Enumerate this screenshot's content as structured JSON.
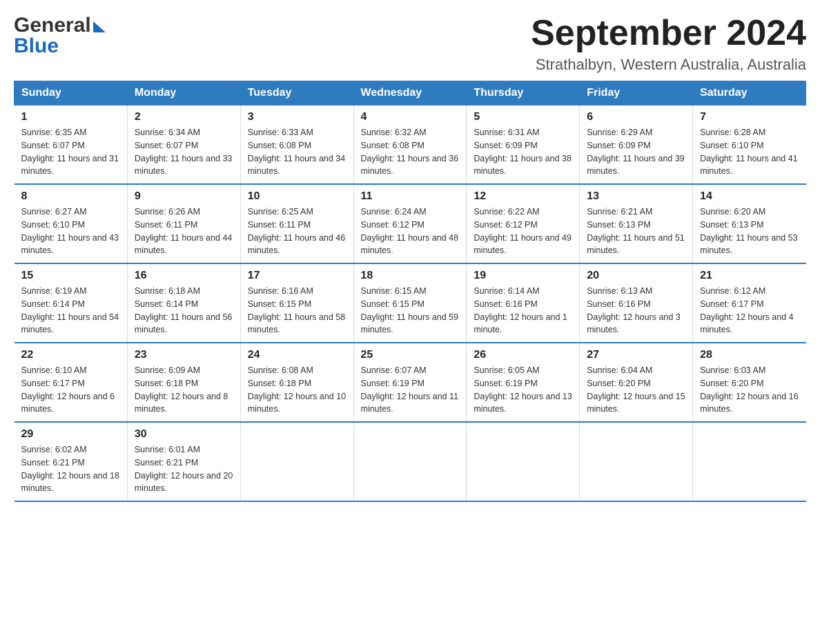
{
  "logo": {
    "general": "General",
    "blue": "Blue"
  },
  "title": "September 2024",
  "subtitle": "Strathalbyn, Western Australia, Australia",
  "weekdays": [
    "Sunday",
    "Monday",
    "Tuesday",
    "Wednesday",
    "Thursday",
    "Friday",
    "Saturday"
  ],
  "weeks": [
    [
      {
        "day": "1",
        "sunrise": "Sunrise: 6:35 AM",
        "sunset": "Sunset: 6:07 PM",
        "daylight": "Daylight: 11 hours and 31 minutes."
      },
      {
        "day": "2",
        "sunrise": "Sunrise: 6:34 AM",
        "sunset": "Sunset: 6:07 PM",
        "daylight": "Daylight: 11 hours and 33 minutes."
      },
      {
        "day": "3",
        "sunrise": "Sunrise: 6:33 AM",
        "sunset": "Sunset: 6:08 PM",
        "daylight": "Daylight: 11 hours and 34 minutes."
      },
      {
        "day": "4",
        "sunrise": "Sunrise: 6:32 AM",
        "sunset": "Sunset: 6:08 PM",
        "daylight": "Daylight: 11 hours and 36 minutes."
      },
      {
        "day": "5",
        "sunrise": "Sunrise: 6:31 AM",
        "sunset": "Sunset: 6:09 PM",
        "daylight": "Daylight: 11 hours and 38 minutes."
      },
      {
        "day": "6",
        "sunrise": "Sunrise: 6:29 AM",
        "sunset": "Sunset: 6:09 PM",
        "daylight": "Daylight: 11 hours and 39 minutes."
      },
      {
        "day": "7",
        "sunrise": "Sunrise: 6:28 AM",
        "sunset": "Sunset: 6:10 PM",
        "daylight": "Daylight: 11 hours and 41 minutes."
      }
    ],
    [
      {
        "day": "8",
        "sunrise": "Sunrise: 6:27 AM",
        "sunset": "Sunset: 6:10 PM",
        "daylight": "Daylight: 11 hours and 43 minutes."
      },
      {
        "day": "9",
        "sunrise": "Sunrise: 6:26 AM",
        "sunset": "Sunset: 6:11 PM",
        "daylight": "Daylight: 11 hours and 44 minutes."
      },
      {
        "day": "10",
        "sunrise": "Sunrise: 6:25 AM",
        "sunset": "Sunset: 6:11 PM",
        "daylight": "Daylight: 11 hours and 46 minutes."
      },
      {
        "day": "11",
        "sunrise": "Sunrise: 6:24 AM",
        "sunset": "Sunset: 6:12 PM",
        "daylight": "Daylight: 11 hours and 48 minutes."
      },
      {
        "day": "12",
        "sunrise": "Sunrise: 6:22 AM",
        "sunset": "Sunset: 6:12 PM",
        "daylight": "Daylight: 11 hours and 49 minutes."
      },
      {
        "day": "13",
        "sunrise": "Sunrise: 6:21 AM",
        "sunset": "Sunset: 6:13 PM",
        "daylight": "Daylight: 11 hours and 51 minutes."
      },
      {
        "day": "14",
        "sunrise": "Sunrise: 6:20 AM",
        "sunset": "Sunset: 6:13 PM",
        "daylight": "Daylight: 11 hours and 53 minutes."
      }
    ],
    [
      {
        "day": "15",
        "sunrise": "Sunrise: 6:19 AM",
        "sunset": "Sunset: 6:14 PM",
        "daylight": "Daylight: 11 hours and 54 minutes."
      },
      {
        "day": "16",
        "sunrise": "Sunrise: 6:18 AM",
        "sunset": "Sunset: 6:14 PM",
        "daylight": "Daylight: 11 hours and 56 minutes."
      },
      {
        "day": "17",
        "sunrise": "Sunrise: 6:16 AM",
        "sunset": "Sunset: 6:15 PM",
        "daylight": "Daylight: 11 hours and 58 minutes."
      },
      {
        "day": "18",
        "sunrise": "Sunrise: 6:15 AM",
        "sunset": "Sunset: 6:15 PM",
        "daylight": "Daylight: 11 hours and 59 minutes."
      },
      {
        "day": "19",
        "sunrise": "Sunrise: 6:14 AM",
        "sunset": "Sunset: 6:16 PM",
        "daylight": "Daylight: 12 hours and 1 minute."
      },
      {
        "day": "20",
        "sunrise": "Sunrise: 6:13 AM",
        "sunset": "Sunset: 6:16 PM",
        "daylight": "Daylight: 12 hours and 3 minutes."
      },
      {
        "day": "21",
        "sunrise": "Sunrise: 6:12 AM",
        "sunset": "Sunset: 6:17 PM",
        "daylight": "Daylight: 12 hours and 4 minutes."
      }
    ],
    [
      {
        "day": "22",
        "sunrise": "Sunrise: 6:10 AM",
        "sunset": "Sunset: 6:17 PM",
        "daylight": "Daylight: 12 hours and 6 minutes."
      },
      {
        "day": "23",
        "sunrise": "Sunrise: 6:09 AM",
        "sunset": "Sunset: 6:18 PM",
        "daylight": "Daylight: 12 hours and 8 minutes."
      },
      {
        "day": "24",
        "sunrise": "Sunrise: 6:08 AM",
        "sunset": "Sunset: 6:18 PM",
        "daylight": "Daylight: 12 hours and 10 minutes."
      },
      {
        "day": "25",
        "sunrise": "Sunrise: 6:07 AM",
        "sunset": "Sunset: 6:19 PM",
        "daylight": "Daylight: 12 hours and 11 minutes."
      },
      {
        "day": "26",
        "sunrise": "Sunrise: 6:05 AM",
        "sunset": "Sunset: 6:19 PM",
        "daylight": "Daylight: 12 hours and 13 minutes."
      },
      {
        "day": "27",
        "sunrise": "Sunrise: 6:04 AM",
        "sunset": "Sunset: 6:20 PM",
        "daylight": "Daylight: 12 hours and 15 minutes."
      },
      {
        "day": "28",
        "sunrise": "Sunrise: 6:03 AM",
        "sunset": "Sunset: 6:20 PM",
        "daylight": "Daylight: 12 hours and 16 minutes."
      }
    ],
    [
      {
        "day": "29",
        "sunrise": "Sunrise: 6:02 AM",
        "sunset": "Sunset: 6:21 PM",
        "daylight": "Daylight: 12 hours and 18 minutes."
      },
      {
        "day": "30",
        "sunrise": "Sunrise: 6:01 AM",
        "sunset": "Sunset: 6:21 PM",
        "daylight": "Daylight: 12 hours and 20 minutes."
      },
      null,
      null,
      null,
      null,
      null
    ]
  ]
}
